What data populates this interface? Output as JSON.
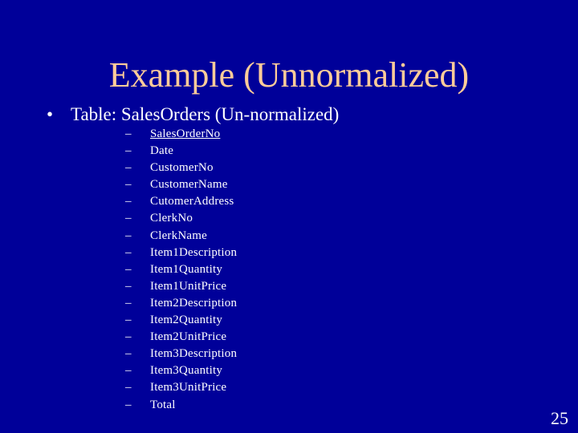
{
  "slide": {
    "title": "Example (Unnormalized)",
    "bullet": {
      "marker": "•",
      "text": "Table: SalesOrders (Un-normalized)"
    },
    "dash_marker": "–",
    "fields": [
      {
        "label": "SalesOrderNo",
        "underlined": true
      },
      {
        "label": "Date",
        "underlined": false
      },
      {
        "label": "CustomerNo",
        "underlined": false
      },
      {
        "label": "CustomerName",
        "underlined": false
      },
      {
        "label": "CutomerAddress",
        "underlined": false
      },
      {
        "label": "ClerkNo",
        "underlined": false
      },
      {
        "label": "ClerkName",
        "underlined": false
      },
      {
        "label": "Item1Description",
        "underlined": false
      },
      {
        "label": "Item1Quantity",
        "underlined": false
      },
      {
        "label": "Item1UnitPrice",
        "underlined": false
      },
      {
        "label": "Item2Description",
        "underlined": false
      },
      {
        "label": "Item2Quantity",
        "underlined": false
      },
      {
        "label": "Item2UnitPrice",
        "underlined": false
      },
      {
        "label": "Item3Description",
        "underlined": false
      },
      {
        "label": "Item3Quantity",
        "underlined": false
      },
      {
        "label": "Item3UnitPrice",
        "underlined": false
      },
      {
        "label": "Total",
        "underlined": false
      }
    ],
    "page_number": "25",
    "colors": {
      "background": "#000099",
      "title": "#ffcc99",
      "body_text": "#ffffff"
    }
  }
}
